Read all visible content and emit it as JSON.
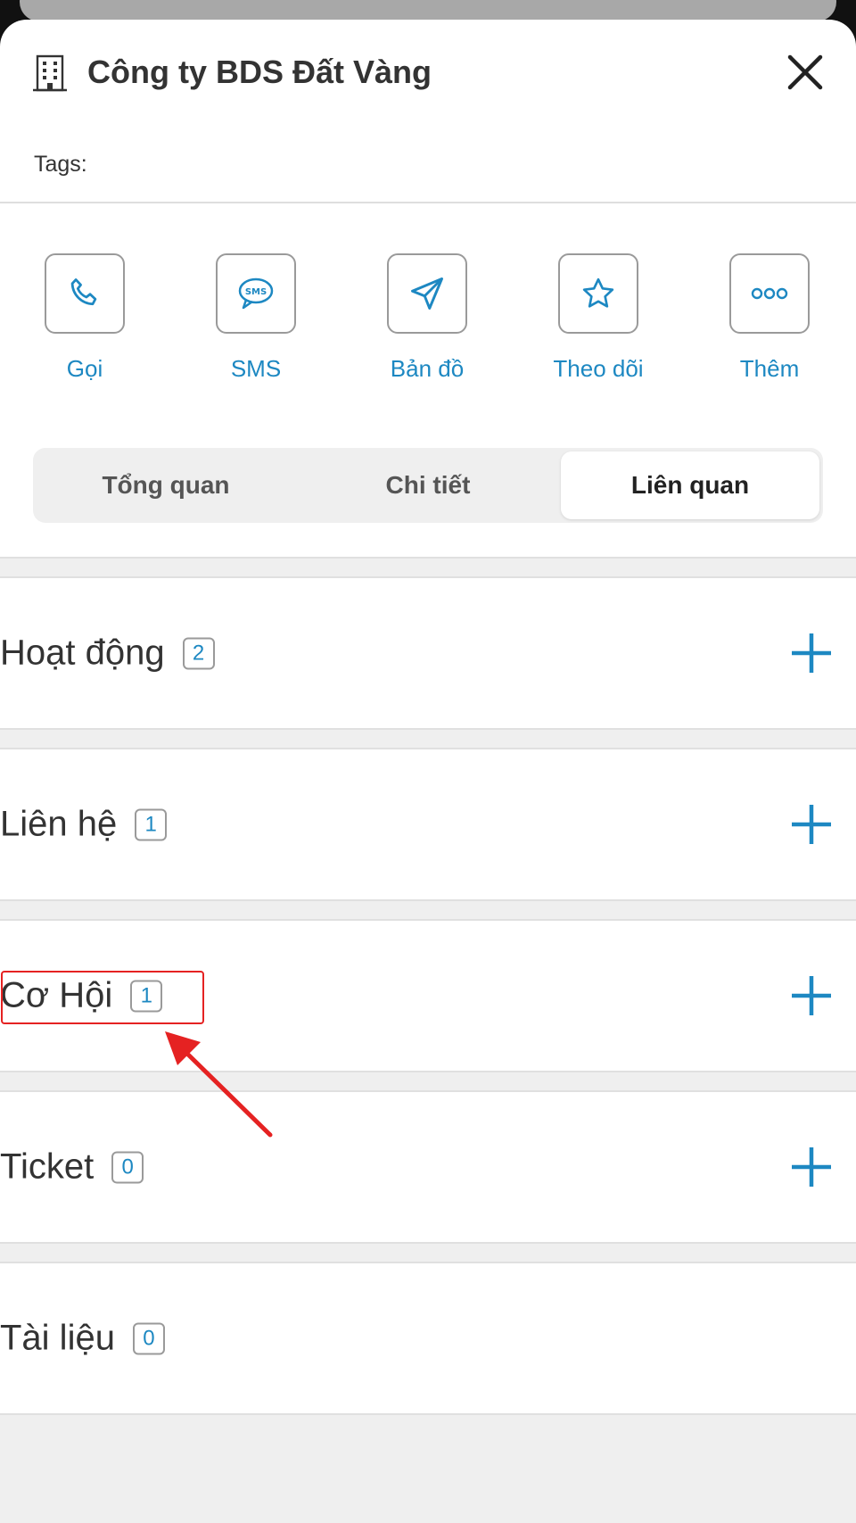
{
  "header": {
    "title": "Công ty BDS Đất Vàng",
    "tags_label": "Tags:"
  },
  "actions": [
    {
      "label": "Gọi",
      "icon": "phone-icon"
    },
    {
      "label": "SMS",
      "icon": "sms-icon"
    },
    {
      "label": "Bản đồ",
      "icon": "navigation-icon"
    },
    {
      "label": "Theo dõi",
      "icon": "star-icon"
    },
    {
      "label": "Thêm",
      "icon": "more-icon"
    }
  ],
  "tabs": [
    {
      "label": "Tổng quan",
      "active": false
    },
    {
      "label": "Chi tiết",
      "active": false
    },
    {
      "label": "Liên quan",
      "active": true
    }
  ],
  "sections": [
    {
      "label": "Hoạt động",
      "count": "2"
    },
    {
      "label": "Liên hệ",
      "count": "1"
    },
    {
      "label": "Cơ Hội",
      "count": "1"
    },
    {
      "label": "Ticket",
      "count": "0"
    },
    {
      "label": "Tài liệu",
      "count": "0"
    }
  ],
  "colors": {
    "accent": "#1d88c2",
    "highlight": "#e52222",
    "background_gray": "#efefef"
  }
}
